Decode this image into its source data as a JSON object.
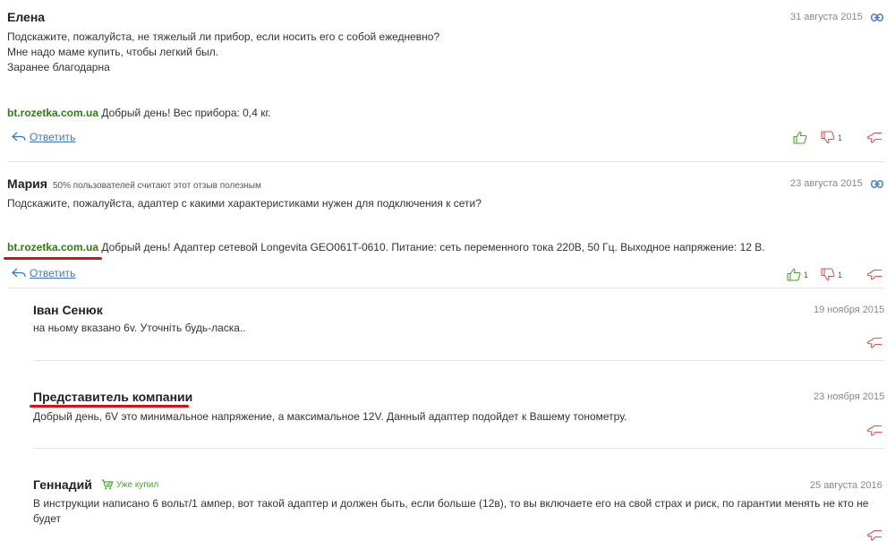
{
  "reviews": [
    {
      "author": "Елена",
      "date": "31 августа 2015",
      "lines": [
        "Подскажите, пожалуйста, не тяжелый ли прибор, если носить его с собой ежедневно?",
        "Мне надо маме купить, чтобы легкий был.",
        "Заранее благодарна"
      ],
      "answer_source": "bt.rozetka.com.ua",
      "answer_text": " Добрый день! Вес прибора: 0,4 кг.",
      "reply_label": "Ответить",
      "likes": "",
      "dislikes": "1"
    },
    {
      "author": "Мария",
      "helpful": "50% пользователей считают этот отзыв полезным",
      "date": "23 августа 2015",
      "lines": [
        "Подскажите, пожалуйста, адаптер с какими характеристиками нужен для подключения к сети?"
      ],
      "answer_source": "bt.rozetka.com.ua",
      "answer_text": " Добрый день! Адаптер сетевой Longevita GEO061T-0610. Питание: сеть переменного тока 220В, 50 Гц. Выходное напряжение: 12 В.",
      "reply_label": "Ответить",
      "likes": "1",
      "dislikes": "1"
    }
  ],
  "replies": [
    {
      "author": "Іван Сенюк",
      "date": "19 ноября 2015",
      "text": "на ньому вказано 6v. Уточніть будь-ласка.."
    },
    {
      "author": "Представитель компании",
      "date": "23 ноября 2015",
      "text": "Добрый день, 6V это минимальное напряжение, а максимальное 12V. Данный адаптер подойдет к Вашему тонометру."
    },
    {
      "author": "Геннадий",
      "badge": "Уже купил",
      "date": "25 августа 2016",
      "lines": [
        "В инструкции написано 6 вольт/1 ампер, вот такой адаптер и должен быть, если больше (12в), то вы включаете его на свой страх и риск, по гарантии менять не кто не",
        "будет"
      ]
    }
  ],
  "colors": {
    "shop_green": "#2f7d12",
    "link_blue": "#3b74c4",
    "like_green": "#4aa628",
    "dislike_red": "#d9534f",
    "highlight_red": "#d0141a"
  },
  "icons": [
    "link-icon",
    "reply-arrow-icon",
    "thumb-up-icon",
    "thumb-down-icon",
    "report-icon",
    "cart-icon"
  ]
}
